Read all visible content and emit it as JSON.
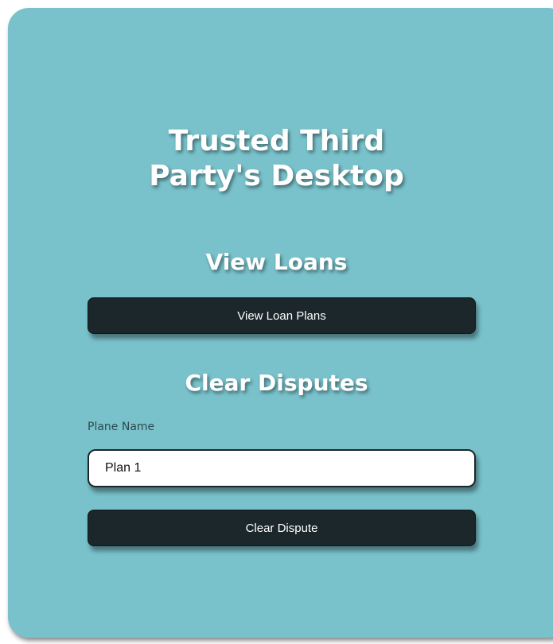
{
  "header": {
    "title_line1": "Trusted Third",
    "title_line2": "Party's Desktop"
  },
  "view_loans": {
    "heading": "View Loans",
    "button_label": "View Loan Plans"
  },
  "clear_disputes": {
    "heading": "Clear Disputes",
    "field_label": "Plane Name",
    "field_value": "Plan 1",
    "button_label": "Clear Dispute"
  },
  "colors": {
    "card_background": "#79c2cb",
    "button_background": "#1b272b",
    "heading_text": "#ffffff"
  }
}
